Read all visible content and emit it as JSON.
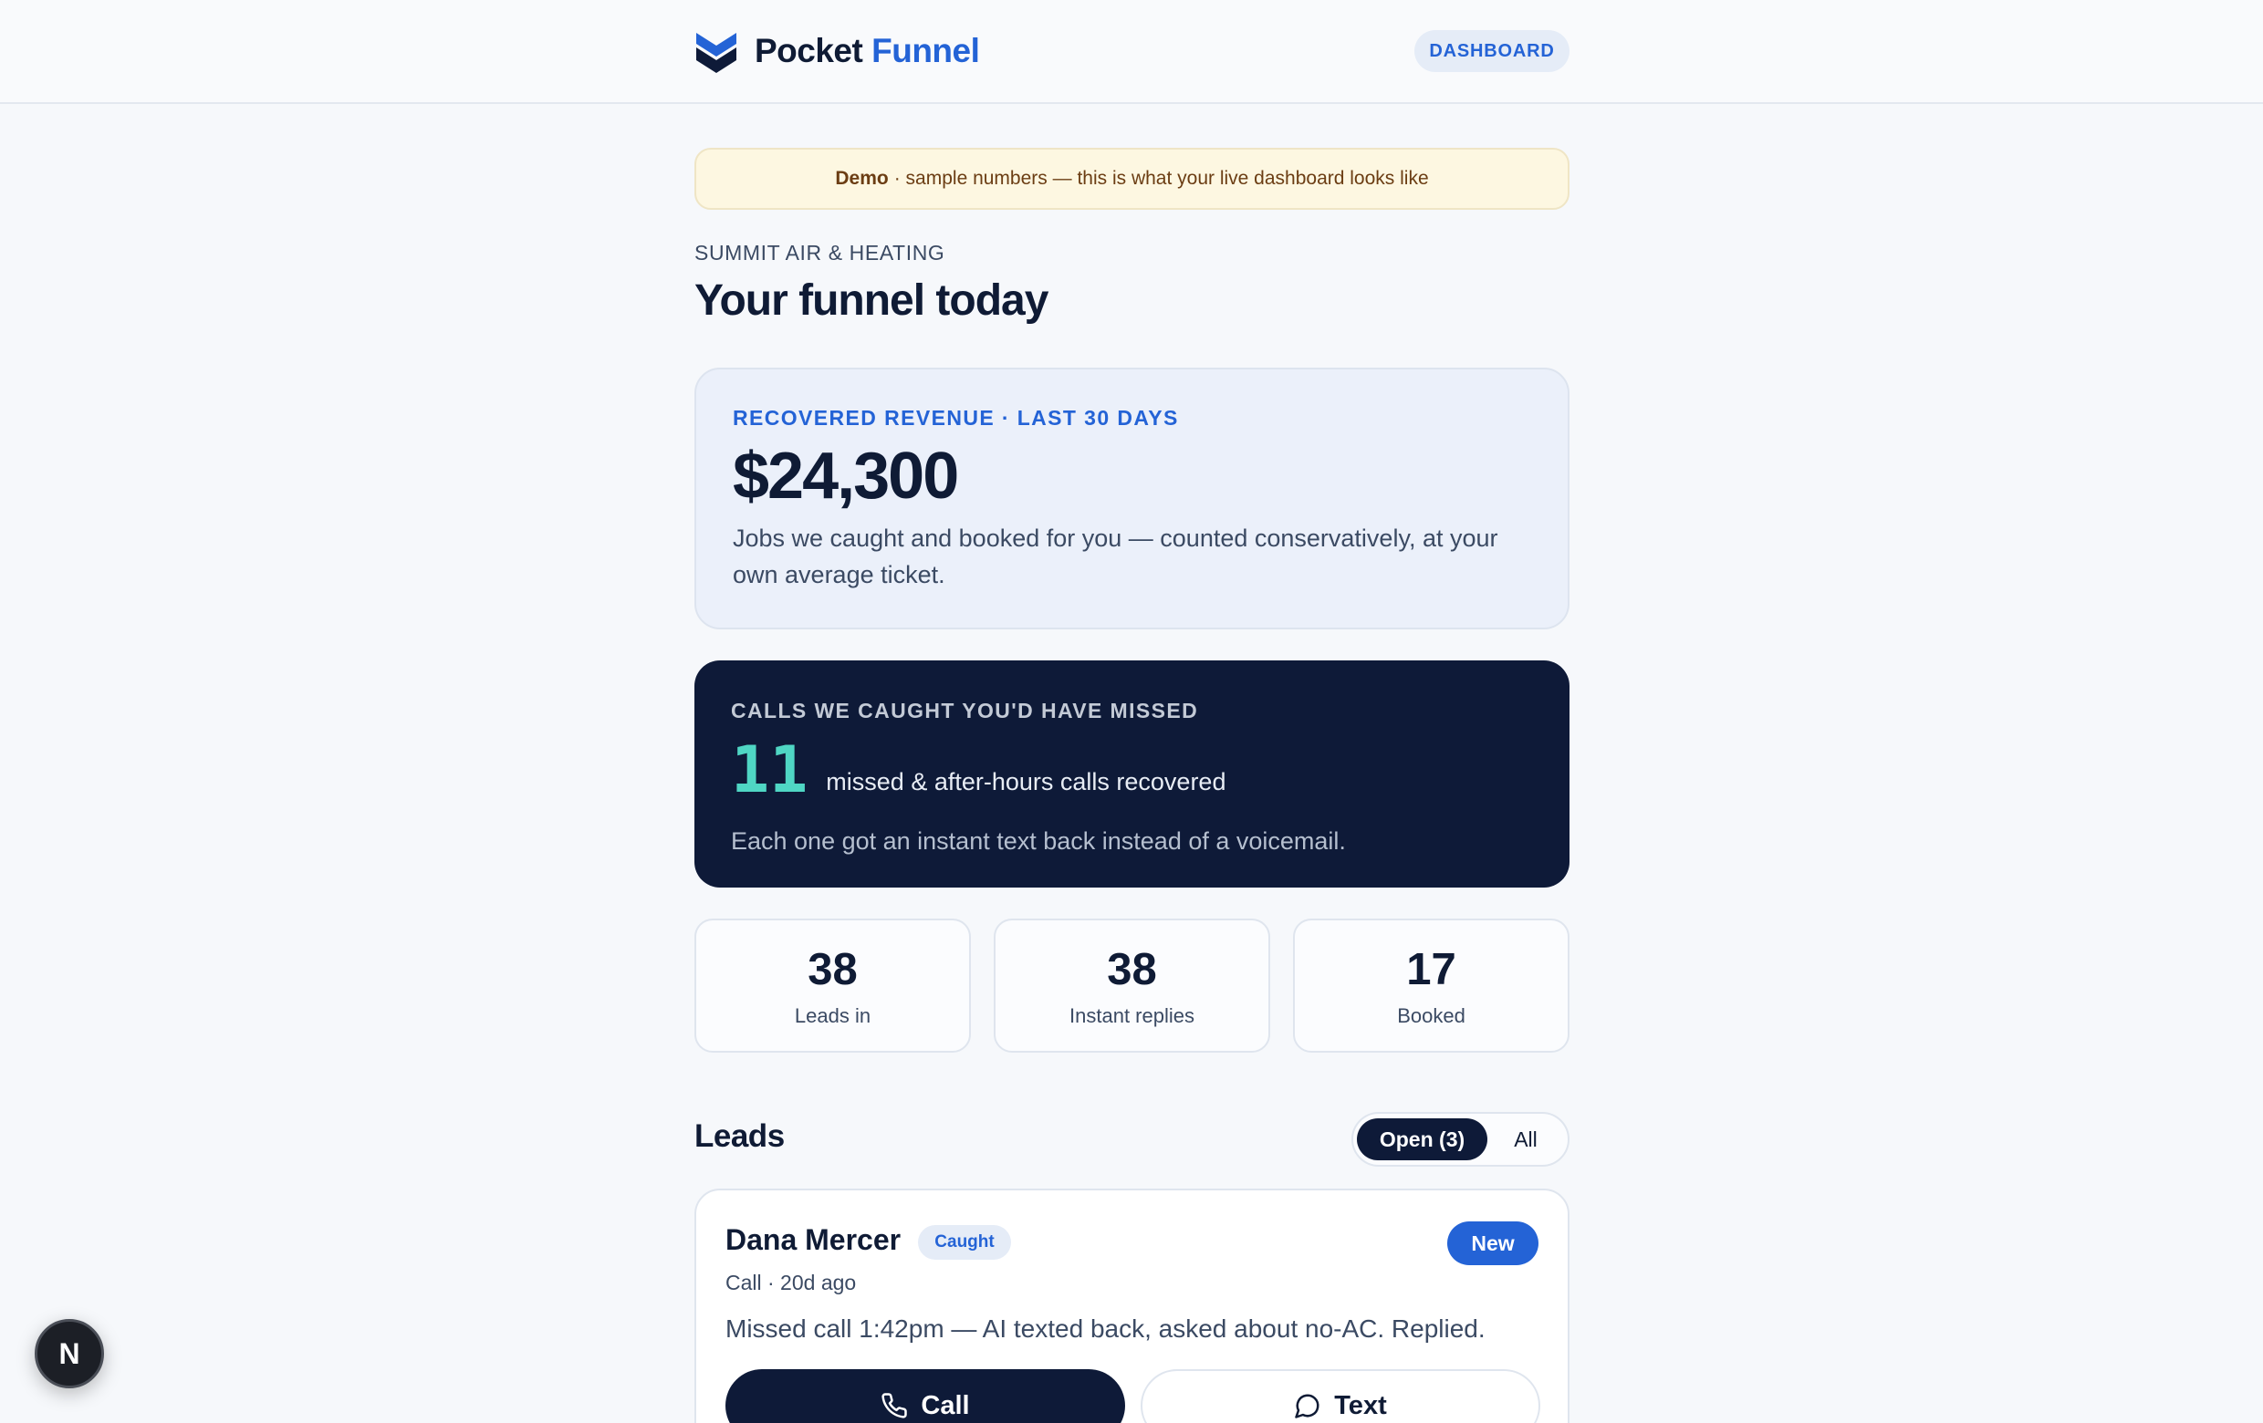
{
  "header": {
    "brand_part1": "Pocket",
    "brand_part2": "Funnel",
    "dashboard_label": "DASHBOARD"
  },
  "banner": {
    "strong": "Demo",
    "text": "· sample numbers — this is what your live dashboard looks like"
  },
  "company": "SUMMIT AIR & HEATING",
  "page_title": "Your funnel today",
  "revenue": {
    "label": "RECOVERED REVENUE · LAST 30 DAYS",
    "value": "$24,300",
    "description": "Jobs we caught and booked for you — counted conservatively, at your own average ticket."
  },
  "missed_calls": {
    "label": "CALLS WE CAUGHT YOU'D HAVE MISSED",
    "count": "11",
    "count_text": "missed & after-hours calls recovered",
    "description": "Each one got an instant text back instead of a voicemail."
  },
  "stats": [
    {
      "value": "38",
      "label": "Leads in"
    },
    {
      "value": "38",
      "label": "Instant replies"
    },
    {
      "value": "17",
      "label": "Booked"
    }
  ],
  "leads": {
    "title": "Leads",
    "filter_open": "Open (3)",
    "filter_all": "All",
    "items": [
      {
        "name": "Dana Mercer",
        "tag": "Caught",
        "status": "New",
        "meta": "Call · 20d ago",
        "note": "Missed call 1:42pm — AI texted back, asked about no-AC. Replied.",
        "call_label": "Call",
        "text_label": "Text"
      }
    ]
  },
  "fab_label": "N",
  "colors": {
    "accent": "#2463d6",
    "navy": "#0e1a38",
    "teal": "#4fd6c4",
    "banner_bg": "#fdf7e1"
  }
}
